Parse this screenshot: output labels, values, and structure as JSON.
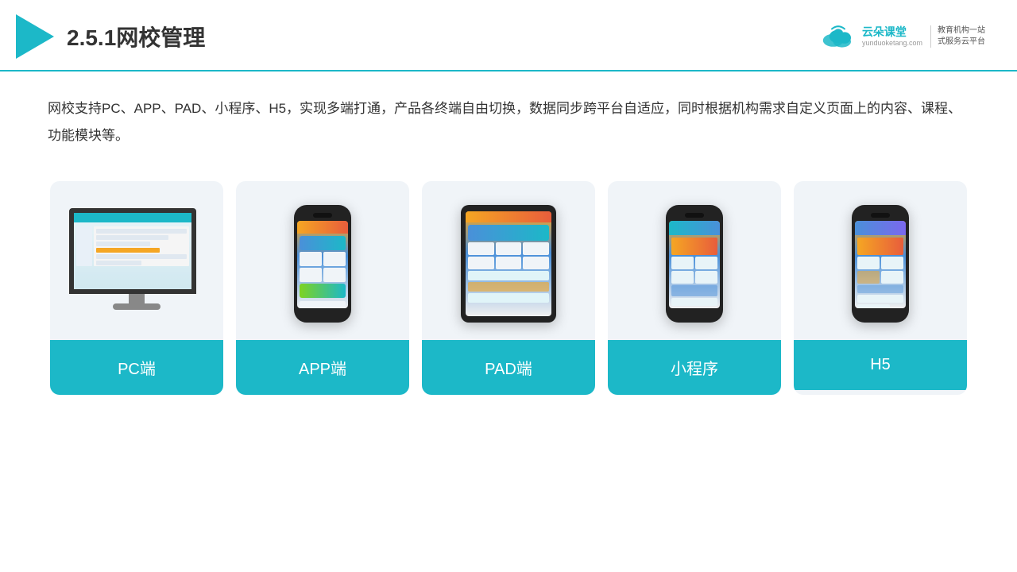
{
  "header": {
    "title": "2.5.1网校管理",
    "brand": {
      "name": "云朵课堂",
      "domain": "yunduoketang.com",
      "slogan": "教育机构一站\n式服务云平台"
    }
  },
  "description": "网校支持PC、APP、PAD、小程序、H5，实现多端打通，产品各终端自由切换，数据同步跨平台自适应，同时根据机构需求自定义页面上的内容、课程、功能模块等。",
  "cards": [
    {
      "id": "pc",
      "label": "PC端"
    },
    {
      "id": "app",
      "label": "APP端"
    },
    {
      "id": "pad",
      "label": "PAD端"
    },
    {
      "id": "miniprogram",
      "label": "小程序"
    },
    {
      "id": "h5",
      "label": "H5"
    }
  ],
  "colors": {
    "teal": "#1cb8c8",
    "accent": "#f5a623",
    "blue": "#4a90d9"
  }
}
